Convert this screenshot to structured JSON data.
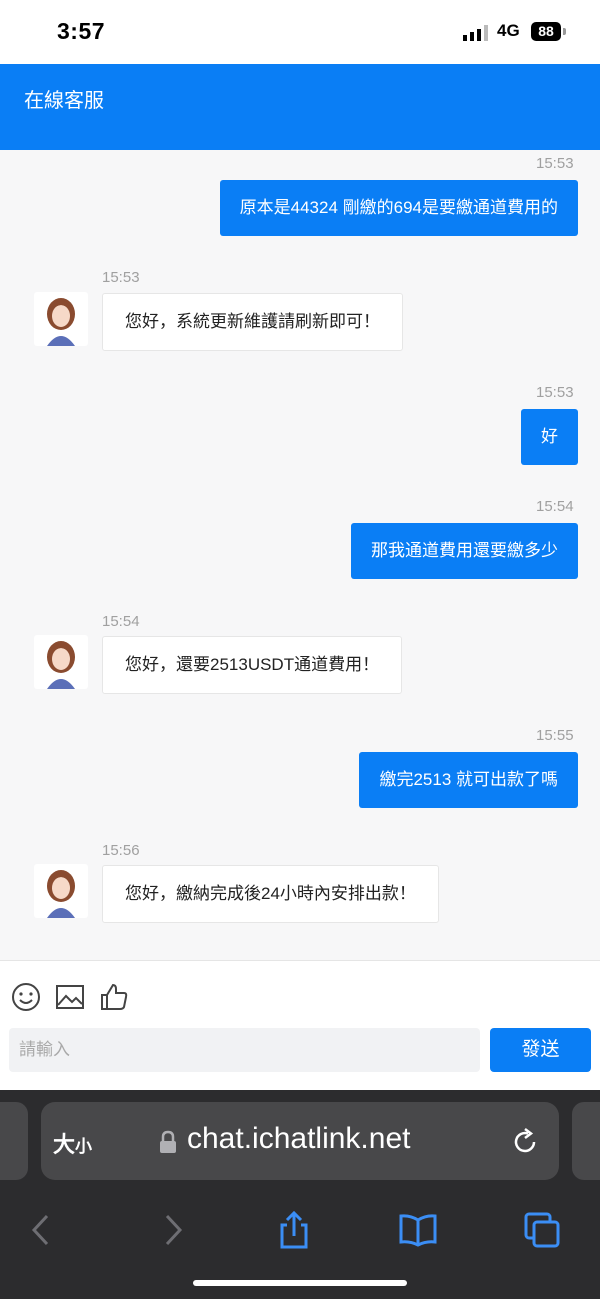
{
  "status_bar": {
    "time": "3:57",
    "network": "4G",
    "battery": "88"
  },
  "header": {
    "title": "在線客服"
  },
  "messages": [
    {
      "time": "15:53",
      "text": "原本是44324 剛繳的694是要繳通道費用的"
    },
    {
      "time": "15:53",
      "text": "您好，系統更新維護請刷新即可！"
    },
    {
      "time": "15:53",
      "text": "好"
    },
    {
      "time": "15:54",
      "text": "那我通道費用還要繳多少"
    },
    {
      "time": "15:54",
      "text": "您好，還要2513USDT通道費用！"
    },
    {
      "time": "15:55",
      "text": "繳完2513 就可出款了嗎"
    },
    {
      "time": "15:56",
      "text": "您好，繳納完成後24小時內安排出款！"
    }
  ],
  "input": {
    "placeholder": "請輸入",
    "send_label": "發送"
  },
  "browser": {
    "text_size_big": "大",
    "text_size_small": "小",
    "url": "chat.ichatlink.net"
  },
  "colors": {
    "accent": "#0a7ef5",
    "background": "#f7f7f8",
    "browser_bg": "#2c2c2e"
  },
  "icons": [
    "emoji-icon",
    "image-icon",
    "thumbs-up-icon",
    "lock-icon",
    "reload-icon",
    "back-icon",
    "forward-icon",
    "share-icon",
    "bookmarks-icon",
    "tabs-icon",
    "signal-icon"
  ]
}
